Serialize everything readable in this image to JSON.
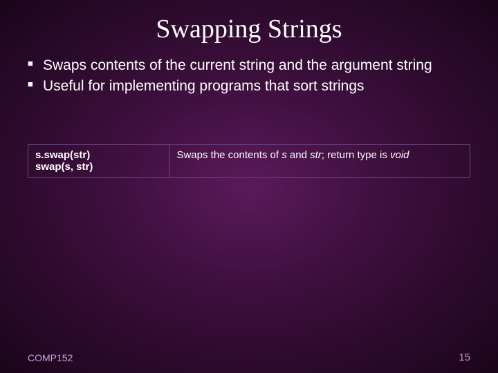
{
  "title": "Swapping Strings",
  "bullets": [
    "Swaps contents of the current string and the argument string",
    "Useful for implementing programs that sort strings"
  ],
  "table": {
    "sig1": "s.swap(str)",
    "sig2": "swap(s, str)",
    "desc_pre": "Swaps the contents of ",
    "desc_s": "s",
    "desc_and": " and ",
    "desc_str": "str",
    "desc_mid": "; return type is ",
    "desc_void": "void"
  },
  "footer": {
    "left": "COMP152",
    "right": "15"
  }
}
